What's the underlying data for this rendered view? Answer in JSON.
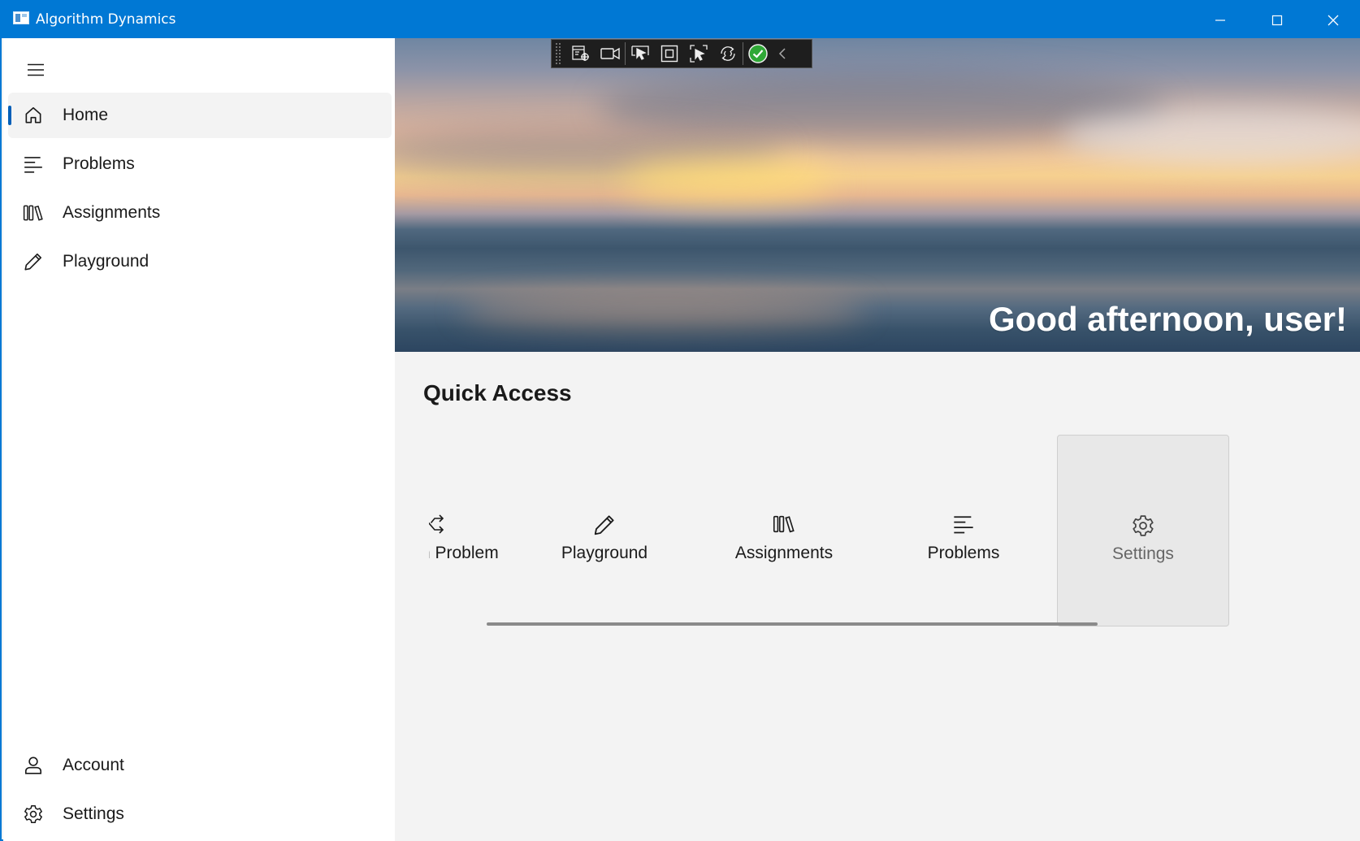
{
  "window": {
    "title": "Algorithm Dynamics",
    "accent": "#0078d4"
  },
  "sidebar": {
    "menu_icon": "hamburger-icon",
    "items": [
      {
        "label": "Home",
        "icon": "home-icon",
        "selected": true
      },
      {
        "label": "Problems",
        "icon": "list-icon"
      },
      {
        "label": "Assignments",
        "icon": "books-icon"
      },
      {
        "label": "Playground",
        "icon": "pencil-icon"
      }
    ],
    "footer_items": [
      {
        "label": "Account",
        "icon": "person-icon"
      },
      {
        "label": "Settings",
        "icon": "gear-icon"
      }
    ]
  },
  "hero": {
    "greeting": "Good afternoon, user!"
  },
  "devtools": {
    "buttons": [
      "live-visual-tree-icon",
      "record-icon",
      "select-element-icon",
      "display-layout-adorners-icon",
      "track-focus-icon",
      "hot-reload-icon",
      "binding-ok-icon",
      "collapse-chevron-icon"
    ]
  },
  "quick_access": {
    "title": "Quick Access",
    "items": [
      {
        "label": "Random Problem",
        "icon": "shuffle-icon"
      },
      {
        "label": "Playground",
        "icon": "pencil-icon"
      },
      {
        "label": "Assignments",
        "icon": "books-icon"
      },
      {
        "label": "Problems",
        "icon": "list-icon"
      },
      {
        "label": "Settings",
        "icon": "gear-icon",
        "hovered": true
      }
    ]
  }
}
